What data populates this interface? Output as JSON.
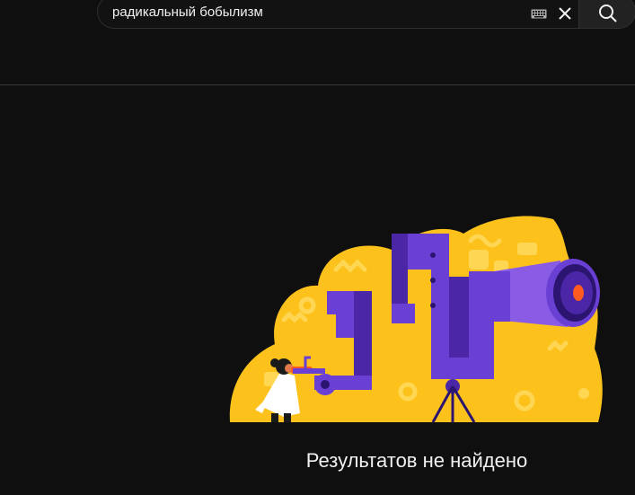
{
  "search": {
    "query": "радикальный бобылизм",
    "keyboard_icon": "keyboard-icon",
    "clear_icon": "close-icon",
    "submit_icon": "search-icon"
  },
  "empty_state": {
    "illustration": "telescope-scientist-illustration",
    "title": "Результатов не найдено",
    "subtitle": ""
  },
  "colors": {
    "background": "#0f0f0f",
    "blob_yellow": "#fcc21b",
    "purple": "#6a3fd4",
    "purple_dark": "#4b27a8",
    "lens_orange": "#ff5a1f"
  }
}
